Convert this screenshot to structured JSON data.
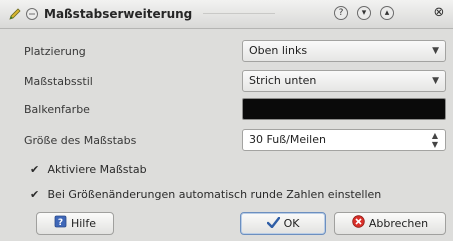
{
  "window": {
    "title": "Maßstabserweiterung",
    "icons": [
      "pencil-icon",
      "circle-icon"
    ],
    "buttons": [
      "help-icon",
      "minimize-icon",
      "maximize-icon",
      "close-icon"
    ]
  },
  "form": {
    "placement_label": "Platzierung",
    "placement_value": "Oben links",
    "style_label": "Maßstabsstil",
    "style_value": "Strich unten",
    "bar_color_label": "Balkenfarbe",
    "bar_color": "#0a0a0a",
    "size_label": "Größe des Maßstabs",
    "size_value": "30 Fuß/Meilen"
  },
  "checks": {
    "enable_label": "Aktiviere Maßstab",
    "enable_checked": true,
    "round_label": "Bei Größenänderungen automatisch runde Zahlen einstellen",
    "round_checked": true
  },
  "buttons": {
    "help_label": "Hilfe",
    "ok_label": "OK",
    "cancel_label": "Abbrechen"
  }
}
